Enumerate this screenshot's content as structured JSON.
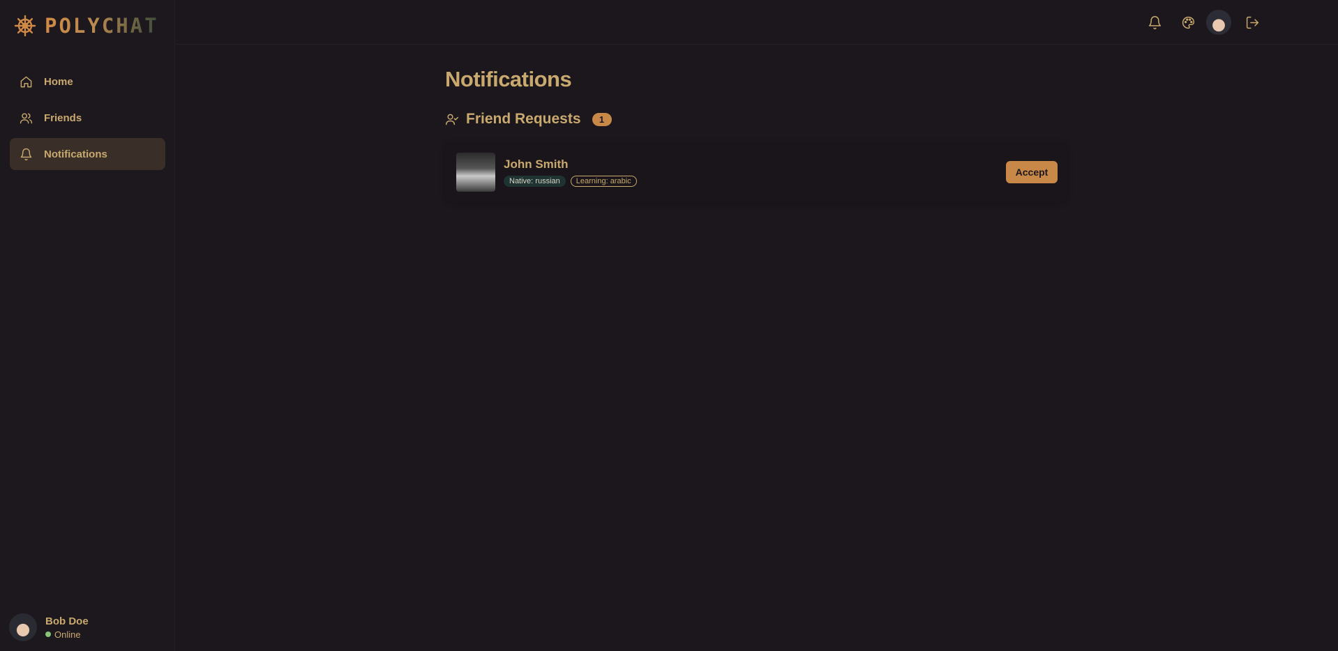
{
  "brand": {
    "name": "POLYCHAT",
    "icon": "ship-wheel-icon"
  },
  "sidebar": {
    "items": [
      {
        "label": "Home",
        "icon": "home-icon",
        "active": false
      },
      {
        "label": "Friends",
        "icon": "users-icon",
        "active": false
      },
      {
        "label": "Notifications",
        "icon": "bell-icon",
        "active": true
      }
    ]
  },
  "user": {
    "name": "Bob Doe",
    "status": "Online"
  },
  "header": {
    "actions": [
      "bell-icon",
      "palette-icon",
      "avatar",
      "logout-icon"
    ]
  },
  "main": {
    "title": "Notifications",
    "section": {
      "title": "Friend Requests",
      "count": "1"
    },
    "requests": [
      {
        "name": "John Smith",
        "native": "Native: russian",
        "learning": "Learning: arabic",
        "accept_label": "Accept"
      }
    ]
  },
  "colors": {
    "background": "#1c171d",
    "accent": "#c88848",
    "text": "#c9a96e",
    "active_nav": "#3a2f28",
    "online": "#86c47a"
  }
}
